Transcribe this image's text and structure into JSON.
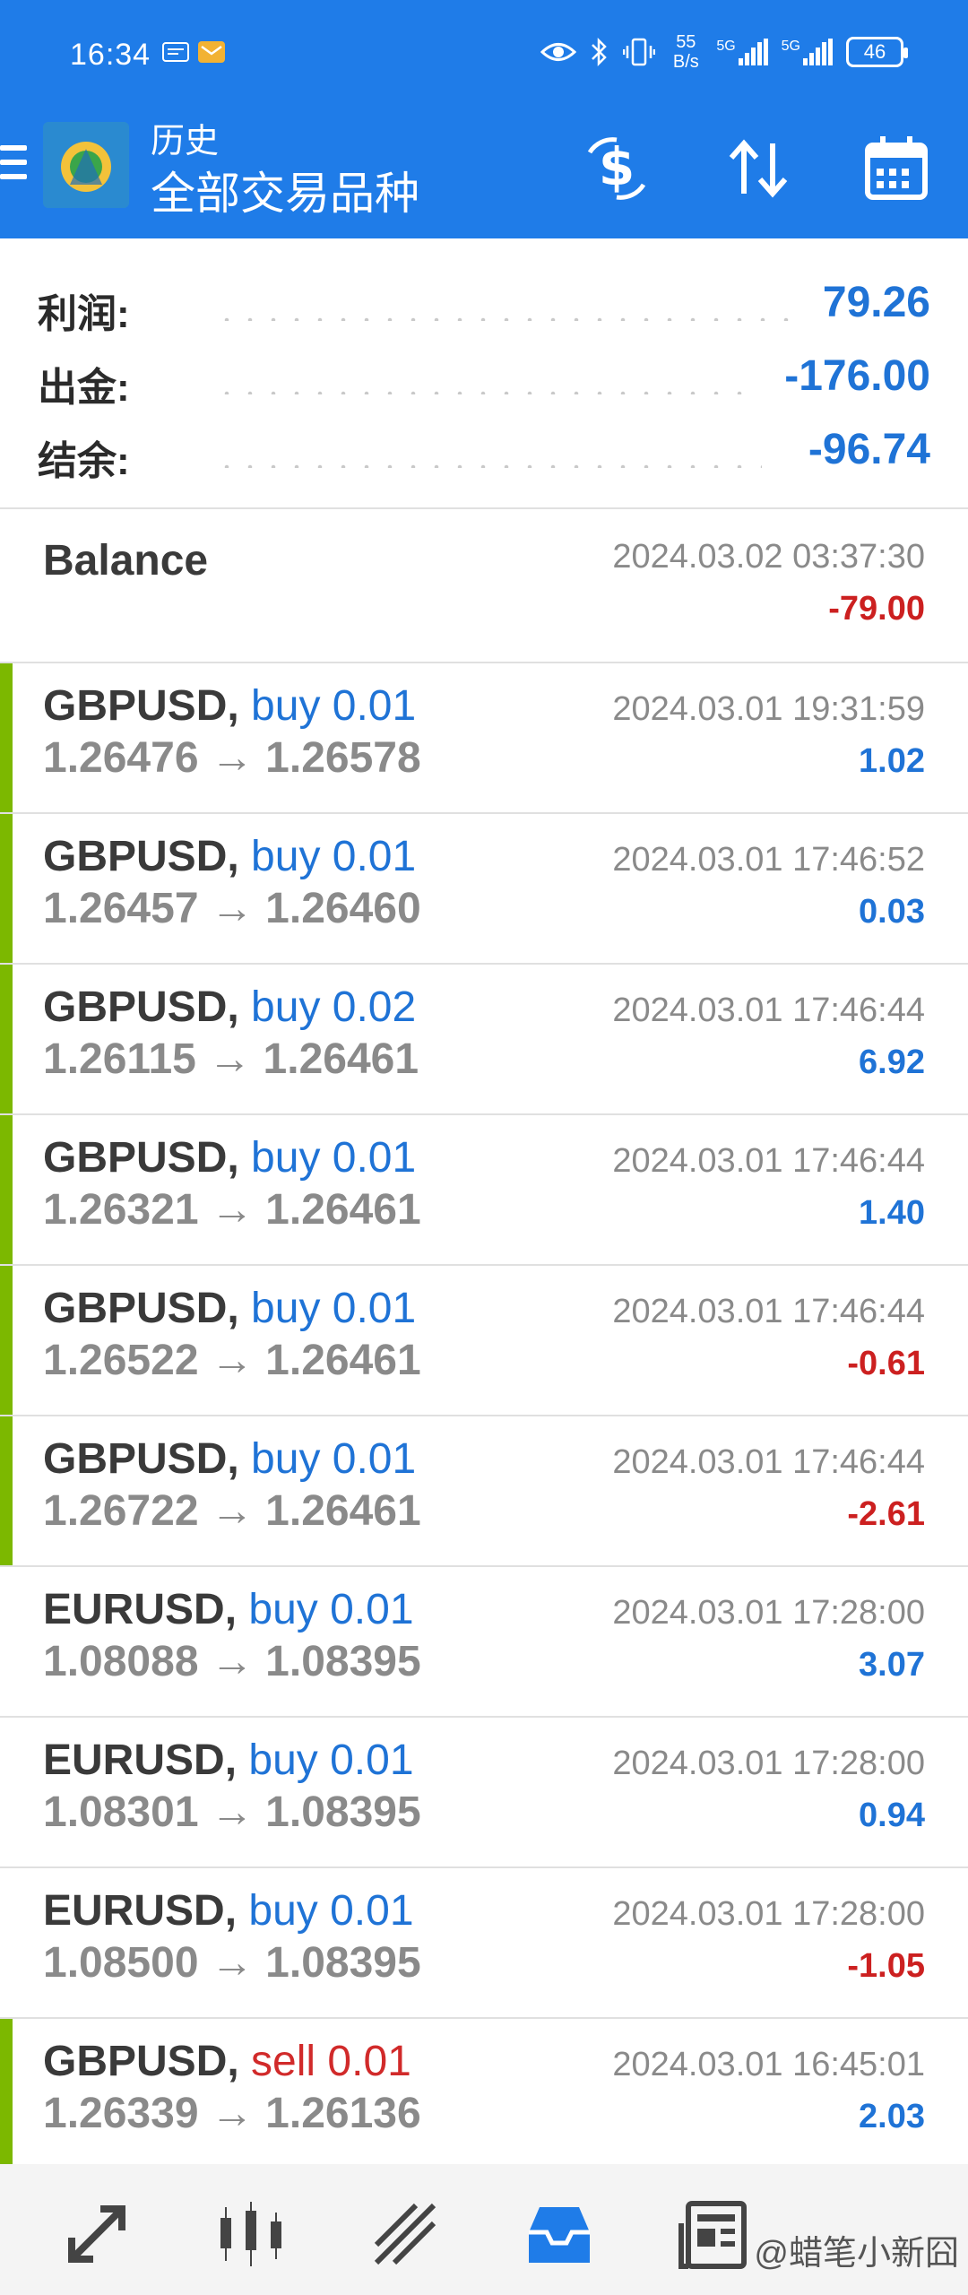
{
  "status_bar": {
    "time": "16:34",
    "net_speed_value": "55",
    "net_speed_unit": "B/s",
    "signal1_label": "5G",
    "signal2_label": "5G",
    "battery": "46"
  },
  "app_bar": {
    "subtitle": "历史",
    "title": "全部交易品种",
    "colors": {
      "background": "#1f7ce8",
      "text": "#ffffff"
    }
  },
  "summary": [
    {
      "label": "利润:",
      "value": "79.26"
    },
    {
      "label": "出金:",
      "value": "-176.00"
    },
    {
      "label": "结余:",
      "value": "-96.74"
    }
  ],
  "balance_row": {
    "label": "Balance",
    "datetime": "2024.03.02 03:37:30",
    "amount": "-79.00"
  },
  "deals": [
    {
      "symbol": "GBPUSD,",
      "side": "buy 0.01",
      "prices": "1.26476 → 1.26578",
      "datetime": "2024.03.01 19:31:59",
      "profit": "1.02",
      "stripe": true
    },
    {
      "symbol": "GBPUSD,",
      "side": "buy 0.01",
      "prices": "1.26457 → 1.26460",
      "datetime": "2024.03.01 17:46:52",
      "profit": "0.03",
      "stripe": true
    },
    {
      "symbol": "GBPUSD,",
      "side": "buy 0.02",
      "prices": "1.26115 → 1.26461",
      "datetime": "2024.03.01 17:46:44",
      "profit": "6.92",
      "stripe": true
    },
    {
      "symbol": "GBPUSD,",
      "side": "buy 0.01",
      "prices": "1.26321 → 1.26461",
      "datetime": "2024.03.01 17:46:44",
      "profit": "1.40",
      "stripe": true
    },
    {
      "symbol": "GBPUSD,",
      "side": "buy 0.01",
      "prices": "1.26522 → 1.26461",
      "datetime": "2024.03.01 17:46:44",
      "profit": "-0.61",
      "stripe": true
    },
    {
      "symbol": "GBPUSD,",
      "side": "buy 0.01",
      "prices": "1.26722 → 1.26461",
      "datetime": "2024.03.01 17:46:44",
      "profit": "-2.61",
      "stripe": true
    },
    {
      "symbol": "EURUSD,",
      "side": "buy 0.01",
      "prices": "1.08088 → 1.08395",
      "datetime": "2024.03.01 17:28:00",
      "profit": "3.07",
      "stripe": false
    },
    {
      "symbol": "EURUSD,",
      "side": "buy 0.01",
      "prices": "1.08301 → 1.08395",
      "datetime": "2024.03.01 17:28:00",
      "profit": "0.94",
      "stripe": false
    },
    {
      "symbol": "EURUSD,",
      "side": "buy 0.01",
      "prices": "1.08500 → 1.08395",
      "datetime": "2024.03.01 17:28:00",
      "profit": "-1.05",
      "stripe": false
    },
    {
      "symbol": "GBPUSD,",
      "side": "sell 0.01",
      "prices": "1.26339 → 1.26136",
      "datetime": "2024.03.01 16:45:01",
      "profit": "2.03",
      "stripe": true
    }
  ],
  "colors": {
    "positive": "#1f73d6",
    "negative": "#cc2020",
    "stripe": "#7cb800",
    "sell": "#d12a2a"
  },
  "bottom_nav": {
    "items": [
      {
        "icon": "quotes-arrows-icon"
      },
      {
        "icon": "chart-candles-icon"
      },
      {
        "icon": "trade-line-icon"
      },
      {
        "icon": "history-inbox-icon",
        "active": true
      },
      {
        "icon": "news-icon"
      }
    ],
    "watermark": "@蜡笔小新囧"
  }
}
